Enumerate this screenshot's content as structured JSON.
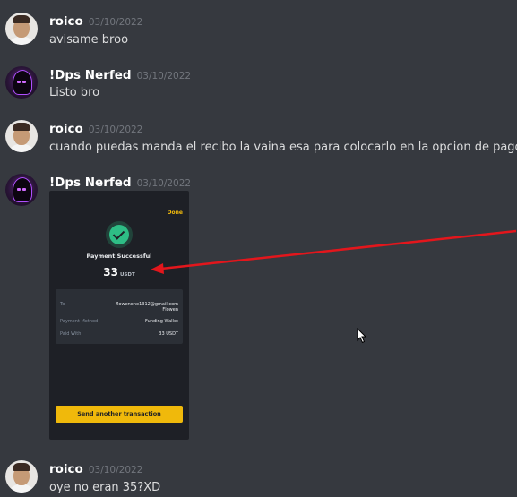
{
  "messages": [
    {
      "author": "roico",
      "date": "03/10/2022",
      "text": "avisame broo"
    },
    {
      "author": "!Dps Nerfed",
      "date": "03/10/2022",
      "text": "Listo bro"
    },
    {
      "author": "roico",
      "date": "03/10/2022",
      "text": "cuando puedas manda el recibo la vaina esa para colocarlo en la opcion de pagos"
    },
    {
      "author": "!Dps Nerfed",
      "date": "03/10/2022"
    },
    {
      "author": "roico",
      "date": "03/10/2022",
      "text": "oye no eran 35?XD"
    }
  ],
  "attachment": {
    "done_label": "Done",
    "title": "Payment Successful",
    "amount": "33",
    "unit": "USDT",
    "to_label": "To",
    "to_email": "flowenone1312@gmail.com",
    "to_name": "Flowen",
    "method_label": "Payment Method",
    "method_value": "Funding Wallet",
    "paid_label": "Paid With",
    "paid_value": "33 USDT",
    "button_label": "Send another transaction"
  },
  "colors": {
    "background": "#36393f",
    "arrow": "#e3161c",
    "confirm": "#2ebd85",
    "button": "#f0b90b"
  }
}
